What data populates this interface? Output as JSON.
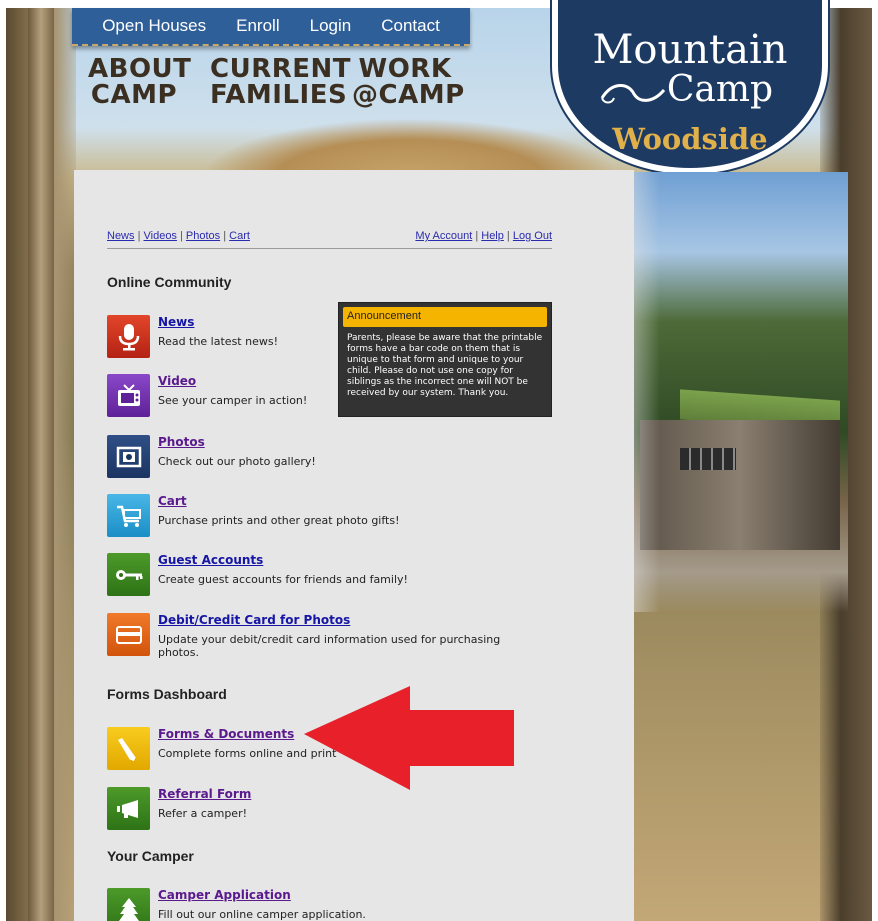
{
  "topnav": {
    "items": [
      "Open Houses",
      "Enroll",
      "Login",
      "Contact"
    ]
  },
  "chalk_nav": {
    "about": [
      "ABOUT",
      "CAMP"
    ],
    "current": [
      "CURRENT",
      "FAMILIES"
    ],
    "work": [
      "WORK",
      "@CAMP"
    ]
  },
  "logo": {
    "line1": "Mountain",
    "line2": "Camp",
    "line3": "Woodside"
  },
  "toplinks": {
    "left": [
      "News",
      "Videos",
      "Photos",
      "Cart"
    ],
    "right": [
      "My Account",
      "Help",
      "Log Out"
    ]
  },
  "sections": {
    "online_community": "Online Community",
    "forms_dashboard": "Forms Dashboard",
    "your_camper": "Your Camper"
  },
  "items": {
    "news": {
      "title": "News",
      "desc": "Read the latest news!"
    },
    "video": {
      "title": "Video",
      "desc": "See your camper in action!"
    },
    "photos": {
      "title": "Photos",
      "desc": "Check out our photo gallery!"
    },
    "cart": {
      "title": "Cart",
      "desc": "Purchase prints and other great photo gifts!"
    },
    "guest": {
      "title": "Guest Accounts",
      "desc": "Create guest accounts for friends and family!"
    },
    "debit": {
      "title": "Debit/Credit Card for Photos",
      "desc": "Update your debit/credit card information used for purchasing photos."
    },
    "forms": {
      "title": "Forms & Documents",
      "desc": "Complete forms online and print"
    },
    "referral": {
      "title": "Referral Form",
      "desc": "Refer a camper!"
    },
    "application": {
      "title": "Camper Application",
      "desc": "Fill out our online camper application."
    }
  },
  "announcement": {
    "title": "Announcement",
    "body": "Parents, please be aware that the printable forms have a bar code on them that is unique to that form and unique to your child. Please do not use one copy for siblings as the incorrect one will NOT be received by our system. Thank you."
  },
  "colors": {
    "nav_blue": "#2f5f98",
    "logo_navy": "#1d3a63",
    "logo_gold": "#e0b04a",
    "announce_yellow": "#f5b400",
    "arrow_red": "#e8202a"
  }
}
